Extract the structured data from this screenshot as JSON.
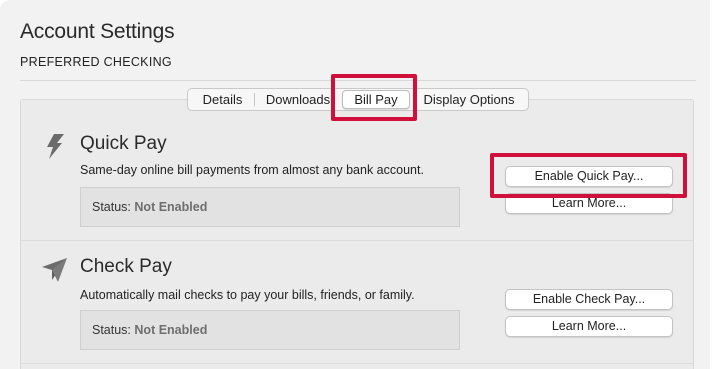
{
  "window": {
    "title": "Account Settings",
    "subtitle": "PREFERRED CHECKING"
  },
  "tabs": [
    {
      "label": "Details"
    },
    {
      "label": "Downloads"
    },
    {
      "label": "Bill Pay",
      "selected": true
    },
    {
      "label": "Display Options"
    }
  ],
  "quick_pay": {
    "icon": "lightning-bolt-icon",
    "title": "Quick Pay",
    "description": "Same-day online bill payments from almost any bank account.",
    "status_label": "Status:",
    "status_value": "Not Enabled",
    "enable_button": "Enable Quick Pay...",
    "learn_more_button": "Learn More..."
  },
  "check_pay": {
    "icon": "paper-plane-icon",
    "title": "Check Pay",
    "description": "Automatically mail checks to pay your bills, friends, or family.",
    "status_label": "Status:",
    "status_value": "Not Enabled",
    "enable_button": "Enable Check Pay...",
    "learn_more_button": "Learn More..."
  },
  "colors": {
    "highlight": "#d0103a",
    "panel_bg": "#ebebeb",
    "status_bg": "#e2e2e2",
    "status_value": "#6e6e6e"
  }
}
